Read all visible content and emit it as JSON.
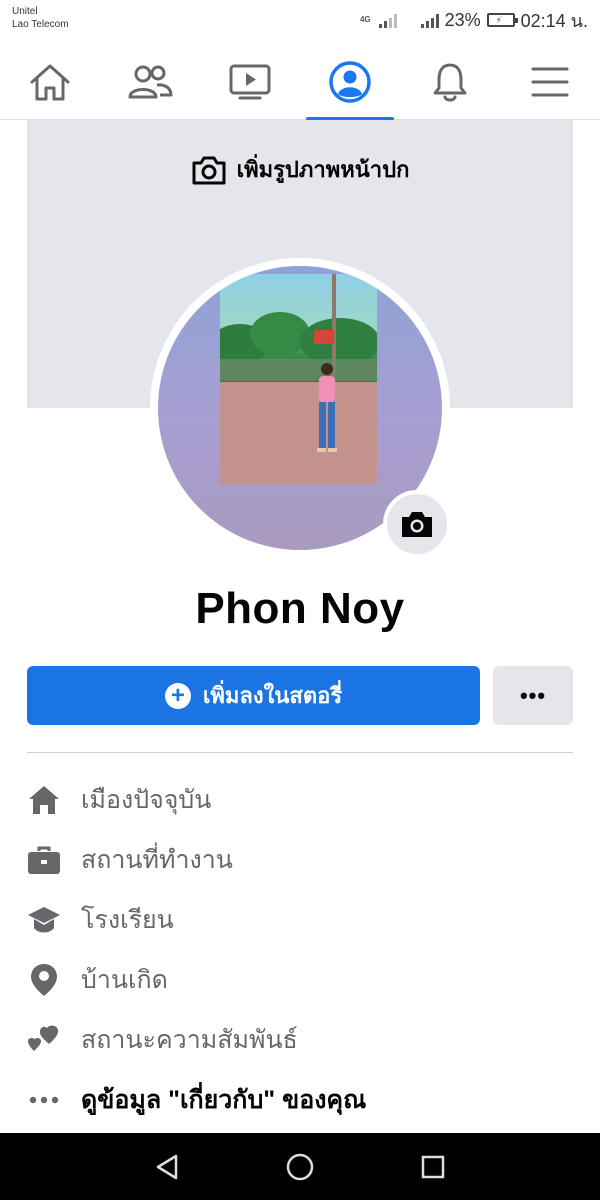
{
  "status_bar": {
    "carrier_line1": "Unitel",
    "carrier_line2": "Lao Telecom",
    "network_badge": "4G",
    "battery_percent": "23%",
    "time": "02:14 น."
  },
  "nav_tabs": [
    {
      "icon": "home-icon",
      "active": false
    },
    {
      "icon": "friends-icon",
      "active": false
    },
    {
      "icon": "watch-icon",
      "active": false
    },
    {
      "icon": "profile-icon",
      "active": true
    },
    {
      "icon": "bell-icon",
      "active": false
    },
    {
      "icon": "menu-icon",
      "active": false
    }
  ],
  "cover": {
    "add_cover_label": "เพิ่มรูปภาพหน้าปก"
  },
  "profile": {
    "name": "Phon Noy"
  },
  "actions": {
    "add_story_label": "เพิ่มลงในสตอรี่",
    "more_label": "•••"
  },
  "details": {
    "current_city": "เมืองปัจจุบัน",
    "workplace": "สถานที่ทำงาน",
    "school": "โรงเรียน",
    "hometown": "บ้านเกิด",
    "relationship": "สถานะความสัมพันธ์",
    "see_about": "ดูข้อมูล \"เกี่ยวกับ\" ของคุณ"
  },
  "colors": {
    "accent": "#1b74e4",
    "cover_bg": "#e4e6eb",
    "muted_text": "#65676b"
  }
}
